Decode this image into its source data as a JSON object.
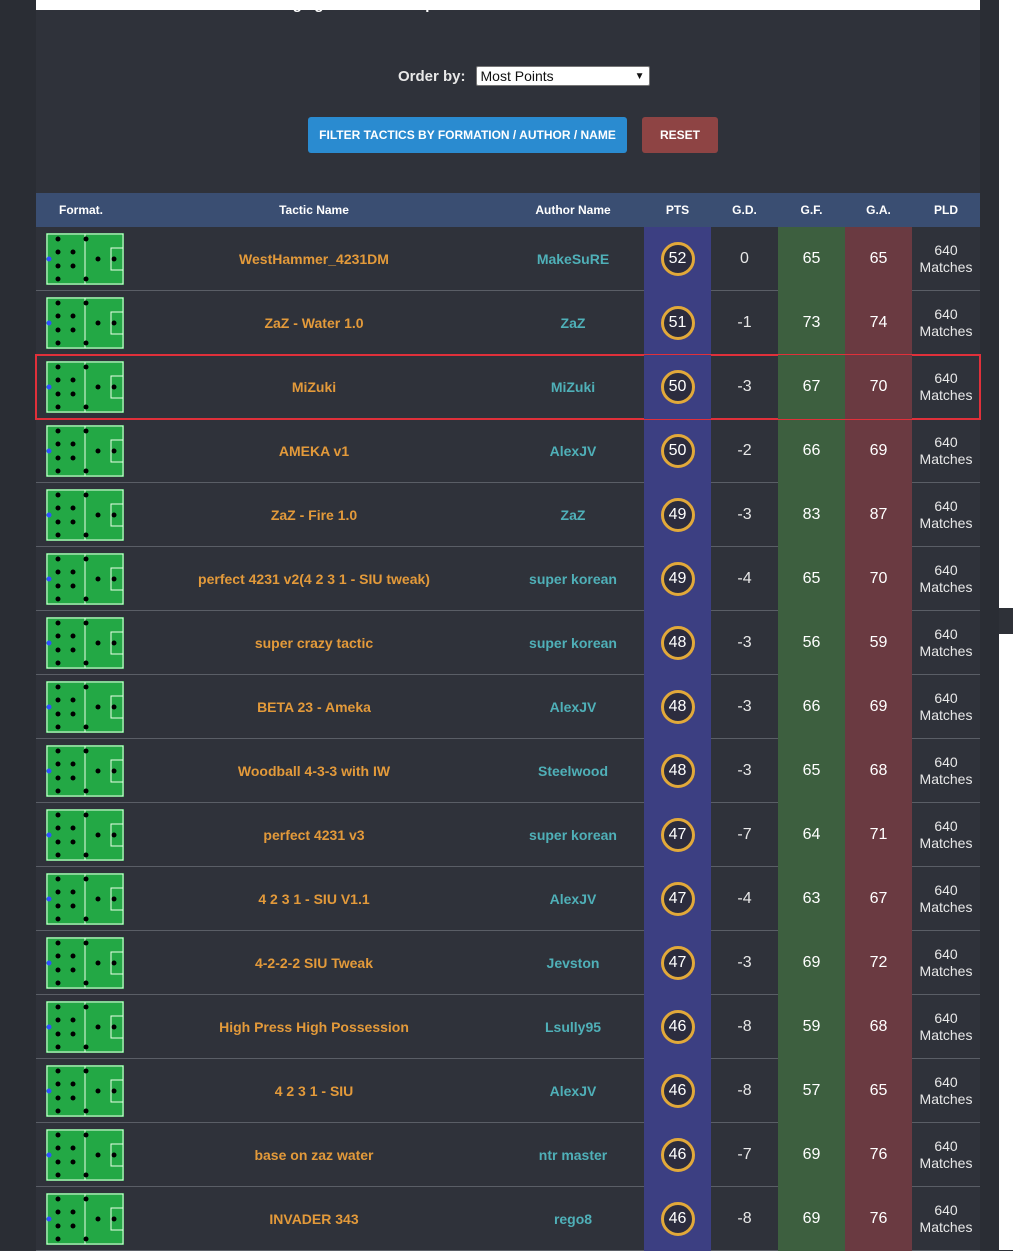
{
  "legend_text": "G.D. - Average goal difference per season.",
  "order": {
    "label": "Order by:",
    "selected": "Most Points"
  },
  "buttons": {
    "filter": "FILTER TACTICS BY FORMATION / AUTHOR / NAME",
    "reset": "RESET"
  },
  "columns": {
    "format": "Format.",
    "name": "Tactic Name",
    "author": "Author Name",
    "pts": "PTS",
    "gd": "G.D.",
    "gf": "G.F.",
    "ga": "G.A.",
    "pld": "PLD"
  },
  "colors": {
    "header": "#3a4e72",
    "pts_bg": "#3c3f82",
    "gf_bg": "#3d5f3f",
    "ga_bg": "#6a3a41",
    "name": "#e39a3a",
    "author": "#4fb0b8",
    "highlight": "#e0303a"
  },
  "rows": [
    {
      "name": "WestHammer_4231DM",
      "author": "MakeSuRE",
      "pts": "52",
      "gd": "0",
      "gf": "65",
      "ga": "65",
      "pld": "640",
      "pld_unit": "Matches"
    },
    {
      "name": "ZaZ - Water 1.0",
      "author": "ZaZ",
      "pts": "51",
      "gd": "-1",
      "gf": "73",
      "ga": "74",
      "pld": "640",
      "pld_unit": "Matches"
    },
    {
      "name": "MiZuki",
      "author": "MiZuki",
      "pts": "50",
      "gd": "-3",
      "gf": "67",
      "ga": "70",
      "pld": "640",
      "pld_unit": "Matches",
      "highlighted": true
    },
    {
      "name": "AMEKA v1",
      "author": "AlexJV",
      "pts": "50",
      "gd": "-2",
      "gf": "66",
      "ga": "69",
      "pld": "640",
      "pld_unit": "Matches"
    },
    {
      "name": "ZaZ - Fire 1.0",
      "author": "ZaZ",
      "pts": "49",
      "gd": "-3",
      "gf": "83",
      "ga": "87",
      "pld": "640",
      "pld_unit": "Matches"
    },
    {
      "name": "perfect 4231 v2(4 2 3 1 - SIU tweak)",
      "author": "super korean",
      "pts": "49",
      "gd": "-4",
      "gf": "65",
      "ga": "70",
      "pld": "640",
      "pld_unit": "Matches"
    },
    {
      "name": "super crazy tactic",
      "author": "super korean",
      "pts": "48",
      "gd": "-3",
      "gf": "56",
      "ga": "59",
      "pld": "640",
      "pld_unit": "Matches"
    },
    {
      "name": "BETA 23 - Ameka",
      "author": "AlexJV",
      "pts": "48",
      "gd": "-3",
      "gf": "66",
      "ga": "69",
      "pld": "640",
      "pld_unit": "Matches"
    },
    {
      "name": "Woodball 4-3-3 with IW",
      "author": "Steelwood",
      "pts": "48",
      "gd": "-3",
      "gf": "65",
      "ga": "68",
      "pld": "640",
      "pld_unit": "Matches"
    },
    {
      "name": "perfect 4231 v3",
      "author": "super korean",
      "pts": "47",
      "gd": "-7",
      "gf": "64",
      "ga": "71",
      "pld": "640",
      "pld_unit": "Matches"
    },
    {
      "name": "4 2 3 1 - SIU V1.1",
      "author": "AlexJV",
      "pts": "47",
      "gd": "-4",
      "gf": "63",
      "ga": "67",
      "pld": "640",
      "pld_unit": "Matches"
    },
    {
      "name": "4-2-2-2 SIU Tweak",
      "author": "Jevston",
      "pts": "47",
      "gd": "-3",
      "gf": "69",
      "ga": "72",
      "pld": "640",
      "pld_unit": "Matches"
    },
    {
      "name": "High Press High Possession",
      "author": "Lsully95",
      "pts": "46",
      "gd": "-8",
      "gf": "59",
      "ga": "68",
      "pld": "640",
      "pld_unit": "Matches"
    },
    {
      "name": "4 2 3 1 - SIU",
      "author": "AlexJV",
      "pts": "46",
      "gd": "-8",
      "gf": "57",
      "ga": "65",
      "pld": "640",
      "pld_unit": "Matches"
    },
    {
      "name": "base on zaz water",
      "author": "ntr master",
      "pts": "46",
      "gd": "-7",
      "gf": "69",
      "ga": "76",
      "pld": "640",
      "pld_unit": "Matches"
    },
    {
      "name": "INVADER 343",
      "author": "rego8",
      "pts": "46",
      "gd": "-8",
      "gf": "69",
      "ga": "76",
      "pld": "640",
      "pld_unit": "Matches"
    }
  ]
}
